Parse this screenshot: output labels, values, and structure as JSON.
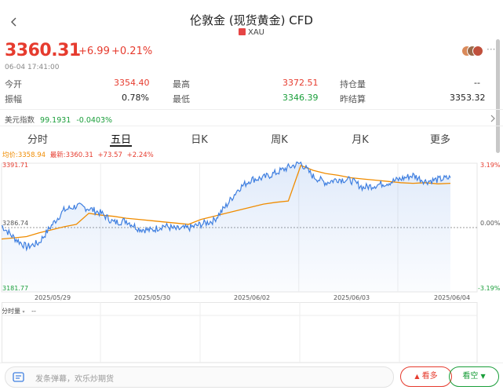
{
  "header": {
    "title": "伦敦金 (现货黄金) CFD",
    "subtitle_code": "XAU"
  },
  "quote": {
    "price": "3360.31",
    "change": "+6.99",
    "change_pct": "+0.21%",
    "time": "06-04 17:41:00"
  },
  "stats": {
    "open_label": "今开",
    "open_value": "3354.40",
    "high_label": "最高",
    "high_value": "3372.51",
    "oi_label": "持仓量",
    "oi_value": "--",
    "amp_label": "振幅",
    "amp_value": "0.78%",
    "low_label": "最低",
    "low_value": "3346.39",
    "prev_label": "昨结算",
    "prev_value": "3353.32"
  },
  "index_row": {
    "label": "美元指数",
    "value": "99.1931",
    "change": "-0.0403%"
  },
  "tabs": [
    "分时",
    "五日",
    "日K",
    "周K",
    "月K",
    "更多"
  ],
  "active_tab": "五日",
  "legend": {
    "avg": "均价:3358.94",
    "latest": "最新:3360.31",
    "change": "+73.57",
    "change_pct": "+2.24%"
  },
  "axis": {
    "y_top": "3391.71",
    "y_mid": "3286.74",
    "y_bottom": "3181.77",
    "pct_top": "3.19%",
    "pct_mid": "0.00%",
    "pct_bottom": "-3.19%",
    "dates": [
      "2025/05/29",
      "2025/05/30",
      "2025/06/02",
      "2025/06/03",
      "2025/06/04"
    ]
  },
  "volume": {
    "label": "分时量",
    "value": "--"
  },
  "bottom_bar": {
    "placeholder": "发条弹幕，欢乐炒期货",
    "long_label": "看多",
    "short_label": "看空"
  },
  "colors": {
    "up": "#e63b2e",
    "down": "#1a9e3a",
    "price_line": "#3f7fe0",
    "avg_line": "#f08c00"
  },
  "chart_data": {
    "type": "line",
    "ylim": [
      3181.77,
      3391.71
    ],
    "x": [
      "2025/05/29",
      "2025/05/30",
      "2025/06/02",
      "2025/06/03",
      "2025/06/04"
    ],
    "series": [
      {
        "name": "最新",
        "values": [
          3290,
          3270,
          3255,
          3262,
          3290,
          3315,
          3322,
          3318,
          3310,
          3295,
          3298,
          3285,
          3282,
          3290,
          3284,
          3286,
          3292,
          3298,
          3322,
          3350,
          3365,
          3368,
          3376,
          3385,
          3392,
          3370,
          3360,
          3366,
          3364,
          3352,
          3356,
          3360,
          3366,
          3372,
          3362,
          3365,
          3368
        ]
      },
      {
        "name": "均价",
        "values": [
          3268,
          3270,
          3272,
          3278,
          3283,
          3288,
          3292,
          3310,
          3307,
          3305,
          3302,
          3300,
          3298,
          3296,
          3294,
          3292,
          3300,
          3305,
          3310,
          3315,
          3320,
          3325,
          3328,
          3330,
          3388,
          3380,
          3375,
          3372,
          3368,
          3366,
          3364,
          3362,
          3360,
          3359,
          3360,
          3358,
          3359
        ]
      }
    ]
  }
}
